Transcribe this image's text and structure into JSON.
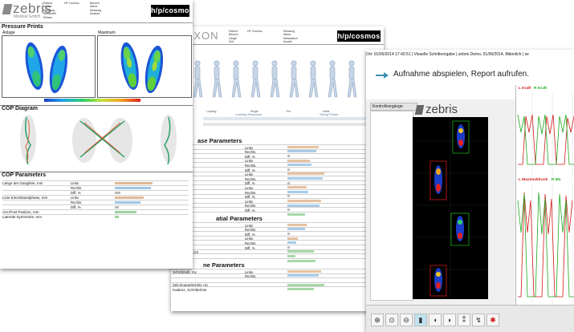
{
  "doc1": {
    "logo_word": "zebris",
    "logo_sub": "Medical GmbH",
    "info_col1": [
      "Patient",
      "Report",
      "Messung",
      "Bearbeitet",
      "Erfasst"
    ],
    "info_col2": [
      "",
      "HP Cosmos",
      "",
      "",
      ""
    ],
    "info_col3": [
      "Besuch",
      "Name",
      "Messung",
      "Analyse",
      ""
    ],
    "brand_box": "h/p/cosmos",
    "pressure_title": "Pressure Prints",
    "pressure_left_label": "Anlage",
    "pressure_right_label": "Maximum",
    "cop_title": "COP Diagram",
    "param_title": "COP Parameters",
    "params": [
      {
        "label": "Länge der Ganglinie, mm",
        "sub": "Links",
        "val": "",
        "w": 0.52,
        "color": "#e0b994"
      },
      {
        "label": "",
        "sub": "Rechts",
        "val": "",
        "w": 0.5,
        "color": "#9ec6e6"
      },
      {
        "label": "",
        "sub": "Diff, %",
        "val": "",
        "w": 0.08,
        "color": "#bbbbbb"
      },
      {
        "label": "Linie Einzelstandphase, mm",
        "sub": "Links",
        "val": "",
        "w": 0.4,
        "color": "#e0b994"
      },
      {
        "label": "",
        "sub": "Rechts",
        "val": "",
        "w": 0.36,
        "color": "#9ec6e6"
      },
      {
        "label": "",
        "sub": "Diff, %",
        "val": "",
        "w": 0.05,
        "color": "#bbbbbb"
      },
      {
        "label": "Ant./Post Position, mm",
        "sub": "",
        "val": "",
        "w": 0.3,
        "color": "#9fd09f"
      },
      {
        "label": "Laterale Symmetrie, mm",
        "sub": "",
        "val": "",
        "w": 0.06,
        "color": "#9fd09f"
      }
    ]
  },
  "doc2": {
    "partial_word": "NXON",
    "brand_box": "h/p/cosmos",
    "roll_left": "Loading Response",
    "roll_right": "Swing Phase",
    "section_titles": [
      "ase Parameters",
      "atial Parameters",
      "ne Parameters"
    ],
    "rows_a": [
      {
        "label": ", %",
        "sub": "Links",
        "w": 0.35
      },
      {
        "label": "",
        "sub": "Rechts",
        "w": 0.33
      },
      {
        "label": "",
        "sub": "Diff, %",
        "w": 0.03
      },
      {
        "label": "ernahme, %",
        "sub": "Links",
        "w": 0.25
      },
      {
        "label": "",
        "sub": "Rechts",
        "w": 0.27
      },
      {
        "label": "",
        "sub": "Diff, %",
        "w": 0.03
      },
      {
        "label": "ndphase, %",
        "sub": "Links",
        "w": 0.42
      },
      {
        "label": "",
        "sub": "Rechts",
        "w": 0.4
      },
      {
        "label": "",
        "sub": "Diff, %",
        "w": 0.03
      },
      {
        "label": "g, %",
        "sub": "Links",
        "w": 0.22
      },
      {
        "label": "",
        "sub": "Rechts",
        "w": 0.24
      },
      {
        "label": "",
        "sub": "Diff, %",
        "w": 0.03
      },
      {
        "label": "se, %",
        "sub": "Links",
        "w": 0.38
      },
      {
        "label": "",
        "sub": "Rechts",
        "w": 0.36
      },
      {
        "label": "",
        "sub": "Diff, %",
        "w": 0.03
      },
      {
        "label": "nphase, %",
        "sub": "",
        "w": 0.2
      }
    ],
    "rows_b": [
      {
        "label": "e, Grad",
        "sub": "Links",
        "w": 0.22
      },
      {
        "label": "",
        "sub": "Rechts",
        "w": 0.2
      },
      {
        "label": "",
        "sub": "Diff, %",
        "w": 0.03
      },
      {
        "label": ", cm",
        "sub": "Links",
        "w": 0.12
      },
      {
        "label": "",
        "sub": "Rechts",
        "w": 0.1
      },
      {
        "label": "",
        "sub": "Diff, %",
        "w": 0.03
      },
      {
        "label": "oppelschritt, cm",
        "sub": "",
        "w": 0.3
      },
      {
        "label": "reite, cm",
        "sub": "",
        "w": 0.09
      },
      {
        "label": "igkeit, km/h",
        "sub": "",
        "w": 0.32
      }
    ],
    "rows_c": [
      {
        "label": "Schrittzahl, mc",
        "sub": "Links",
        "w": 0.38
      },
      {
        "label": "",
        "sub": "Rechts",
        "w": 0.35
      },
      {
        "label": "",
        "sub": "",
        "w": 0.0
      },
      {
        "label": "Zeit Doppelschritt, mc",
        "sub": "",
        "w": 0.42
      },
      {
        "label": "Kadenz, Schritte/min",
        "sub": "",
        "w": 0.3
      }
    ]
  },
  "window": {
    "title": "Ort: 01/06/2014 17:42:51 | Visuelle Schrittvorgabe | zebris Demo, 01/06/2014, Männlich | ze",
    "instruction": "Aufnahme abspielen, Report aufrufen.",
    "tab_label": "Kontrollvorgänge",
    "logo_word": "zebris",
    "right_label_top_a": "L Kraft",
    "right_label_top_b": "R Kraft",
    "right_label_bottom": "L Maximaldruck",
    "right_label_bottom_b": "R Ma",
    "toolbar_icons": [
      "zoom-in-icon",
      "zoom-fit-icon",
      "zoom-out-icon",
      "single-foot-icon",
      "left-foot-icon",
      "right-foot-icon",
      "both-feet-icon",
      "gait-icon",
      "settings-icon"
    ],
    "colors": {
      "left": "#d11a1a",
      "right": "#1ea81e",
      "accent": "#3d8fb5"
    }
  }
}
